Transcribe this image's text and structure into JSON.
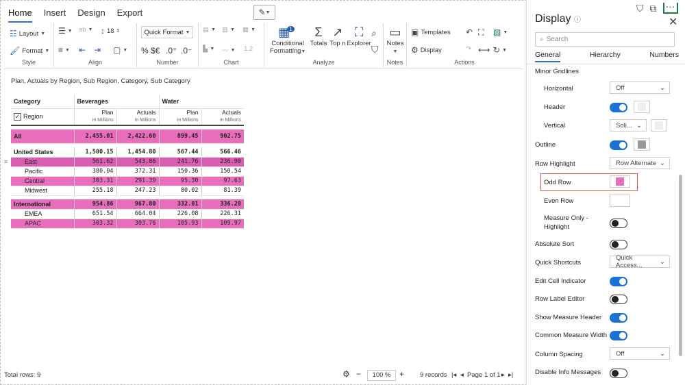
{
  "tabs": [
    "Home",
    "Insert",
    "Design",
    "Export"
  ],
  "ribbon": {
    "style": {
      "layout": "Layout",
      "format": "Format",
      "label": "Style"
    },
    "align": {
      "font_size": "18",
      "label": "Align"
    },
    "number": {
      "format_select": "Quick Format",
      "currency": "%  $€",
      "dec_up": ".0⁺",
      "dec_down": ".0⁻",
      "label": "Number"
    },
    "chart": {
      "label": "Chart",
      "scale": "1.2"
    },
    "analyze": {
      "conditional": "Conditional",
      "formatting": "Formatting",
      "totals": "Totals",
      "topn": "Top n",
      "explorer": "Explorer",
      "badge": "1",
      "label": "Analyze"
    },
    "notes": {
      "notes": "Notes",
      "label": "Notes"
    },
    "actions": {
      "templates": "Templates",
      "display": "Display",
      "label": "Actions"
    }
  },
  "subtitle": "Plan, Actuals by Region, Sub Region, Category, Sub Category",
  "grid": {
    "category_label": "Category",
    "region_label": "Region",
    "groups": [
      "Beverages",
      "Water"
    ],
    "measures": [
      {
        "name": "Plan",
        "unit": "in Millions"
      },
      {
        "name": "Actuals",
        "unit": "in Millions"
      },
      {
        "name": "Plan",
        "unit": "in Millions"
      },
      {
        "name": "Actuals",
        "unit": "in Millions"
      }
    ],
    "rows": [
      {
        "label": "All",
        "values": [
          "2,455.01",
          "2,422.60",
          "899.45",
          "902.75"
        ]
      },
      {
        "label": "United States",
        "values": [
          "1,500.15",
          "1,454.80",
          "567.44",
          "566.46"
        ]
      },
      {
        "label": "East",
        "values": [
          "561.62",
          "543.86",
          "241.76",
          "236.90"
        ]
      },
      {
        "label": "Pacific",
        "values": [
          "380.04",
          "372.31",
          "150.36",
          "150.54"
        ]
      },
      {
        "label": "Central",
        "values": [
          "303.31",
          "291.39",
          "95.30",
          "97.63"
        ]
      },
      {
        "label": "Midwest",
        "values": [
          "255.18",
          "247.23",
          "80.02",
          "81.39"
        ]
      },
      {
        "label": "International",
        "values": [
          "954.86",
          "967.80",
          "332.01",
          "336.28"
        ]
      },
      {
        "label": "EMEA",
        "values": [
          "651.54",
          "664.04",
          "226.08",
          "226.31"
        ]
      },
      {
        "label": "APAC",
        "values": [
          "303.32",
          "303.76",
          "105.93",
          "109.97"
        ]
      }
    ]
  },
  "status": {
    "total_rows": "Total rows: 9",
    "zoom": "100 %",
    "records": "9 records",
    "page": "Page 1 of 1"
  },
  "panel": {
    "title": "Display",
    "search_placeholder": "Search",
    "tabs": [
      "General",
      "Hierarchy",
      "Numbers"
    ],
    "minor_gridlines": "Minor Gridlines",
    "horizontal": "Horizontal",
    "horizontal_value": "Off",
    "header": "Header",
    "vertical": "Vertical",
    "vertical_value": "Soli...",
    "outline": "Outline",
    "row_highlight": "Row Highlight",
    "row_highlight_value": "Row Alternate",
    "odd_row": "Odd Row",
    "even_row": "Even Row",
    "measure_only_1": "Measure Only -",
    "measure_only_2": "Highlight",
    "absolute_sort": "Absolute Sort",
    "quick_shortcuts": "Quick Shortcuts",
    "quick_shortcuts_value": "Quick Access...",
    "edit_cell_indicator": "Edit Cell Indicator",
    "row_label_editor": "Row Label Editor",
    "show_measure_header": "Show Measure Header",
    "common_measure_width": "Common Measure Width",
    "column_spacing": "Column Spacing",
    "column_spacing_value": "Off",
    "disable_info_messages": "Disable Info Messages"
  },
  "colors": {
    "accent": "#1a73d4",
    "highlight_pink": "#e86dbd",
    "odd_row_swatch": "#e86dbd",
    "outline_swatch": "#999999",
    "callout_border": "#e05a5a"
  }
}
